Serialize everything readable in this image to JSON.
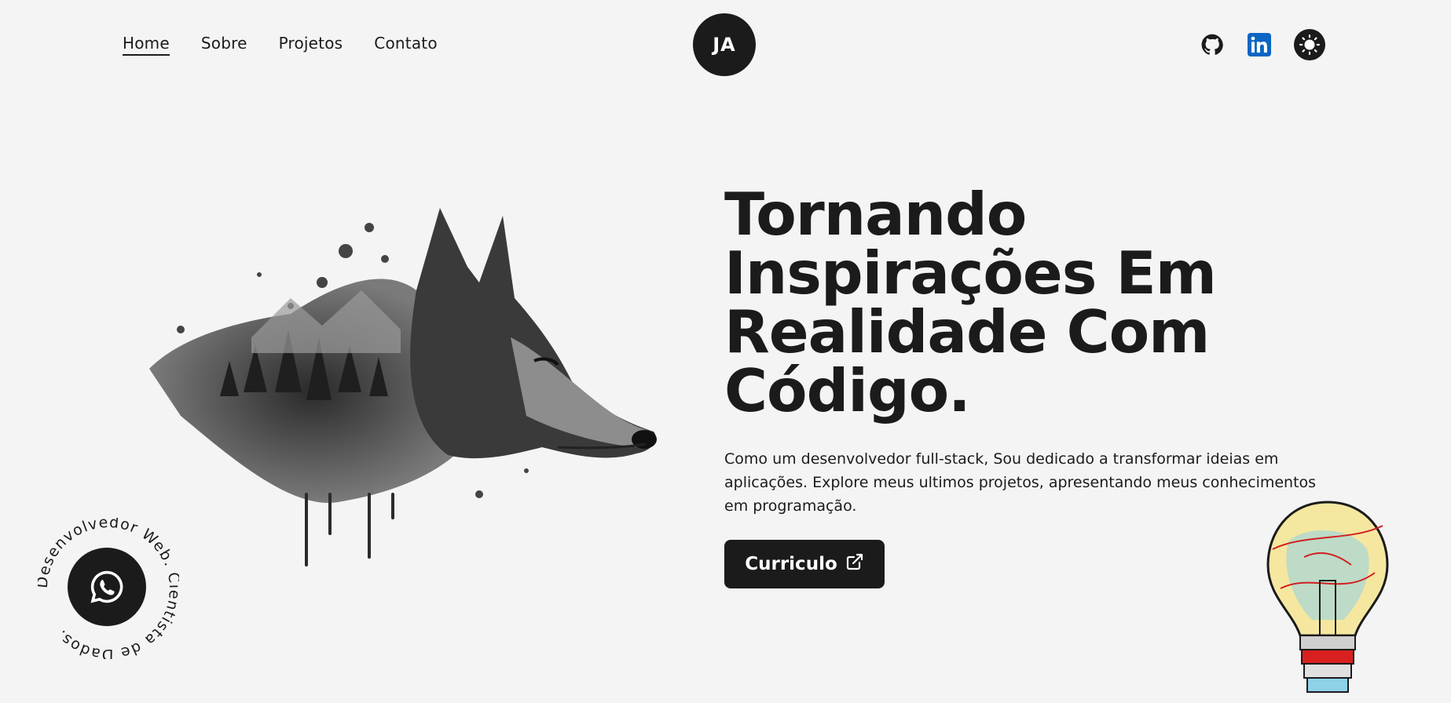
{
  "nav": {
    "items": [
      {
        "label": "Home"
      },
      {
        "label": "Sobre"
      },
      {
        "label": "Projetos"
      },
      {
        "label": "Contato"
      }
    ]
  },
  "logo": {
    "text": "JA"
  },
  "social": {
    "icons": [
      "github-icon",
      "linkedin-icon",
      "theme-toggle-icon"
    ],
    "colors": {
      "linkedin": "#0a66c2"
    }
  },
  "hero": {
    "title": "Tornando Inspirações Em Realidade Com Código.",
    "description": "Como um desenvolvedor full-stack, Sou dedicado a transformar ideias em aplicações. Explore meus ultimos projetos, apresentando meus conhecimentos em programação.",
    "cta_label": "Curriculo"
  },
  "circular_text": "Desenvolvedor Web. Cientista de Dados. ",
  "colors": {
    "background": "#f4f4f4",
    "dark": "#1b1b1b"
  }
}
